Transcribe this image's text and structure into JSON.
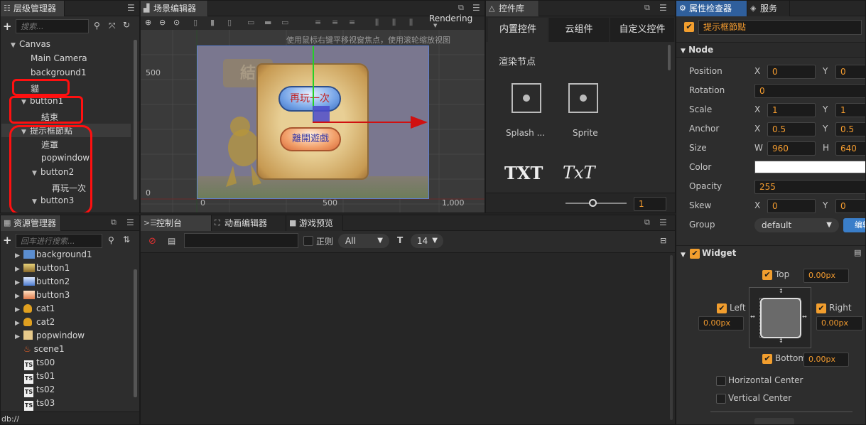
{
  "hierarchy": {
    "title": "层级管理器",
    "search_placeholder": "搜索...",
    "nodes": [
      "Canvas",
      "Main Camera",
      "background1",
      "貓",
      "button1",
      "結束",
      "提示框節點",
      "遮罩",
      "popwindow",
      "button2",
      "再玩一次",
      "button3"
    ]
  },
  "scene": {
    "title": "场景编辑器",
    "mode": "Rendering",
    "hint": "使用鼠标右键平移视窗焦点，使用滚轮缩放视图",
    "axis": {
      "y500": "500",
      "y0": "0",
      "x0": "0",
      "x500": "500",
      "x1000": "1,000"
    },
    "btn_replay": "再玩一次",
    "btn_leave": "離開遊戲",
    "bg_text": "結"
  },
  "widget_lib": {
    "title": "控件库",
    "tabs": [
      "内置控件",
      "云组件",
      "自定义控件"
    ],
    "section": "渲染节点",
    "items": [
      "Splash ...",
      "Sprite",
      "TXT",
      "TxT"
    ],
    "slider_value": "1"
  },
  "inspector": {
    "tabs": [
      "属性检查器",
      "服务"
    ],
    "node_name": "提示框節點",
    "node_section": "Node",
    "props": {
      "position": {
        "label": "Position",
        "x": "0",
        "y": "0"
      },
      "rotation": {
        "label": "Rotation",
        "value": "0"
      },
      "scale": {
        "label": "Scale",
        "x": "1",
        "y": "1"
      },
      "anchor": {
        "label": "Anchor",
        "x": "0.5",
        "y": "0.5"
      },
      "size": {
        "label": "Size",
        "w": "960",
        "h": "640"
      },
      "color": {
        "label": "Color",
        "value": "#ffffff"
      },
      "opacity": {
        "label": "Opacity",
        "value": "255"
      },
      "skew": {
        "label": "Skew",
        "x": "0",
        "y": "0"
      },
      "group": {
        "label": "Group",
        "value": "default",
        "edit": "编辑"
      }
    },
    "axis_labels": {
      "x": "X",
      "y": "Y",
      "w": "W",
      "h": "H"
    },
    "widget": {
      "title": "Widget",
      "top": "Top",
      "top_val": "0.00px",
      "left": "Left",
      "left_val": "0.00px",
      "right": "Right",
      "right_val": "0.00px",
      "bottom": "Bottom",
      "bottom_val": "0.00px",
      "hcenter": "Horizontal Center",
      "vcenter": "Vertical Center"
    }
  },
  "assets": {
    "title": "资源管理器",
    "search_placeholder": "回车进行搜索...",
    "items": [
      "background1",
      "button1",
      "button2",
      "button3",
      "cat1",
      "cat2",
      "popwindow",
      "scene1",
      "ts00",
      "ts01",
      "ts02",
      "ts03"
    ],
    "footer": "db://"
  },
  "console": {
    "tabs": [
      "控制台",
      "动画编辑器",
      "游戏预览"
    ],
    "regex": "正则",
    "level": "All",
    "font_size": "14"
  },
  "colors": {
    "accent_orange": "#f39b2f",
    "highlight_red": "#ff1010",
    "tab_blue": "#2f5f9c"
  }
}
